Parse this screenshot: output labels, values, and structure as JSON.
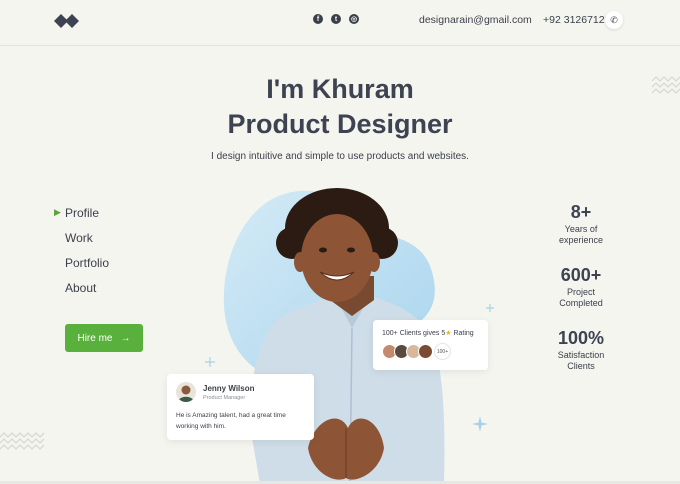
{
  "header": {
    "email": "designarain@gmail.com",
    "phone": "+92 312671235",
    "social_icons": [
      "facebook-icon",
      "twitter-icon",
      "dribbble-icon"
    ]
  },
  "hero": {
    "title_line1": "I'm Khuram",
    "title_line2": "Product Designer",
    "subtitle": "I design intuitive and simple to use products and websites."
  },
  "nav": {
    "items": [
      {
        "label": "Profile",
        "active": true
      },
      {
        "label": "Work",
        "active": false
      },
      {
        "label": "Portfolio",
        "active": false
      },
      {
        "label": "About",
        "active": false
      }
    ],
    "hire_label": "Hire me"
  },
  "rating_card": {
    "text_before": "100+ Clients gives 5",
    "text_after": " Rating",
    "more_label": "100+"
  },
  "testimonial": {
    "name": "Jenny Wilson",
    "role": "Product Manager",
    "text": "He is Amazing talent, had a great time working with him."
  },
  "stats": [
    {
      "value": "8+",
      "label_line1": "Years of",
      "label_line2": "experience"
    },
    {
      "value": "600+",
      "label_line1": "Project",
      "label_line2": "Completed"
    },
    {
      "value": "100%",
      "label_line1": "Satisfaction",
      "label_line2": "Clients"
    }
  ],
  "colors": {
    "accent_green": "#5ab03d",
    "text_dark": "#3d4351",
    "background": "#f5f5f0",
    "blob_blue": "#bfe0f2",
    "star": "#f2b01e"
  }
}
